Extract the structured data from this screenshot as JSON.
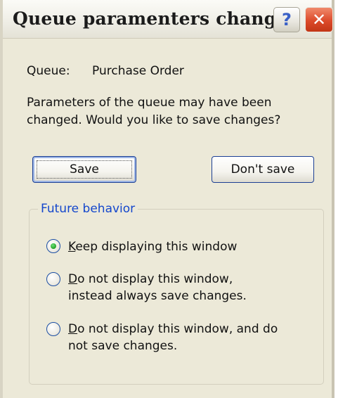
{
  "window": {
    "title": "Queue paramenters change",
    "help_glyph": "?",
    "close_glyph": "✕"
  },
  "queue": {
    "label": "Queue:",
    "value": "Purchase Order"
  },
  "message": {
    "line1": "Parameters of the queue may have been",
    "line2": "changed. Would you like to save changes?"
  },
  "buttons": {
    "save": "Save",
    "dont_save": "Don't save"
  },
  "future_behavior": {
    "legend": "Future behavior",
    "selected_index": 0,
    "options": [
      {
        "mnemonic": "K",
        "line1_rest": "eep displaying this window",
        "line2": ""
      },
      {
        "mnemonic": "D",
        "line1_rest": "o not display this window,",
        "line2": "instead always save changes."
      },
      {
        "mnemonic": "D",
        "line1_rest": "o not display this window, and do",
        "line2": "not save changes."
      }
    ]
  },
  "colors": {
    "dialog_bg": "#ece9d8",
    "legend_text": "#1447cc",
    "close_button": "#dc4a2a",
    "radio_selected": "#21a125"
  },
  "icons": {
    "help": "help-icon",
    "close": "close-icon"
  }
}
